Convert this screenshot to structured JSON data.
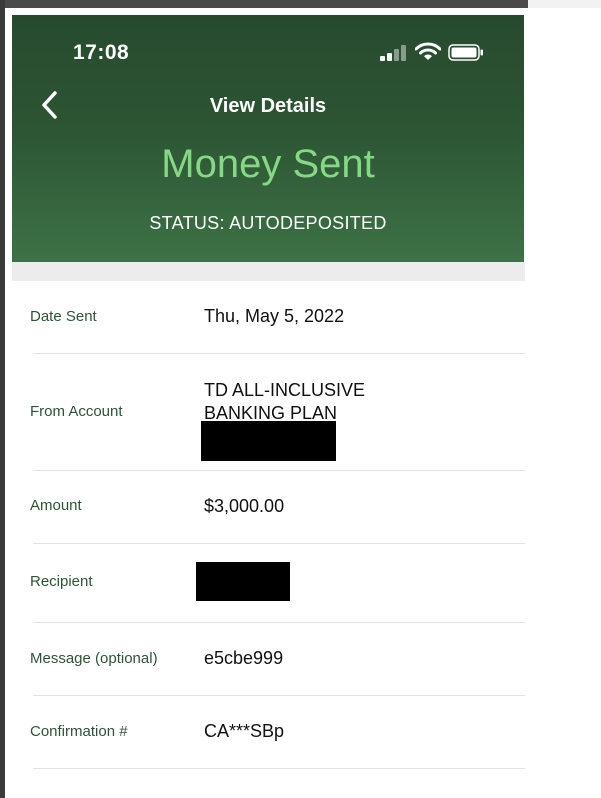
{
  "status_bar": {
    "time": "17:08"
  },
  "nav": {
    "title": "View Details"
  },
  "hero": {
    "title": "Money Sent",
    "status": "STATUS: AUTODEPOSITED"
  },
  "details": {
    "date_sent": {
      "label": "Date Sent",
      "value": "Thu, May 5, 2022"
    },
    "from_account": {
      "label": "From Account",
      "line1": "TD ALL-INCLUSIVE",
      "line2": "BANKING PLAN"
    },
    "amount": {
      "label": "Amount",
      "value": "$3,000.00"
    },
    "recipient": {
      "label": "Recipient"
    },
    "message": {
      "label": "Message (optional)",
      "value": "e5cbe999"
    },
    "confirmation": {
      "label": "Confirmation #",
      "value": "CA***SBp"
    }
  },
  "colors": {
    "header_dark": "#274a2e",
    "header_light": "#3d7246",
    "hero_green": "#86d886",
    "label_green": "#2c5533"
  }
}
